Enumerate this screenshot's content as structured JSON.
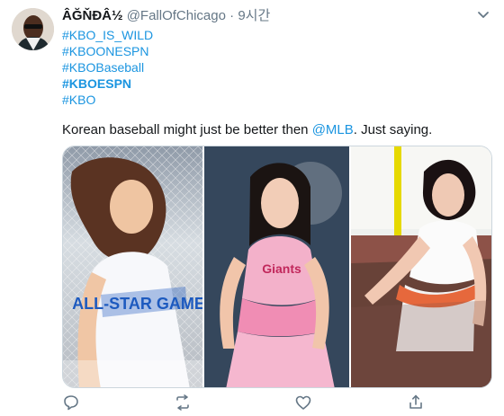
{
  "tweet": {
    "display_name": "ÂĞŇĐÂ½",
    "handle": "@FallOfChicago",
    "separator": "·",
    "timestamp": "9시간",
    "hashtags": [
      "#KBO_IS_WILD",
      "#KBOONESPN",
      "#KBOBaseball",
      "#KBOESPN",
      "#KBO"
    ],
    "text_before_mention": "Korean baseball might just be better then ",
    "mention": "@MLB",
    "text_after_mention": ". Just saying."
  },
  "images": [
    {
      "name": "photo-1",
      "jersey_text": "ALL-STAR GAME"
    },
    {
      "name": "photo-2",
      "jersey_text": "Giants"
    },
    {
      "name": "photo-3"
    }
  ],
  "icons": {
    "reply": "reply-icon",
    "retweet": "retweet-icon",
    "like": "heart-icon",
    "share": "share-icon"
  },
  "colors": {
    "link": "#1b95e0",
    "text": "#14171a",
    "muted": "#657786"
  }
}
